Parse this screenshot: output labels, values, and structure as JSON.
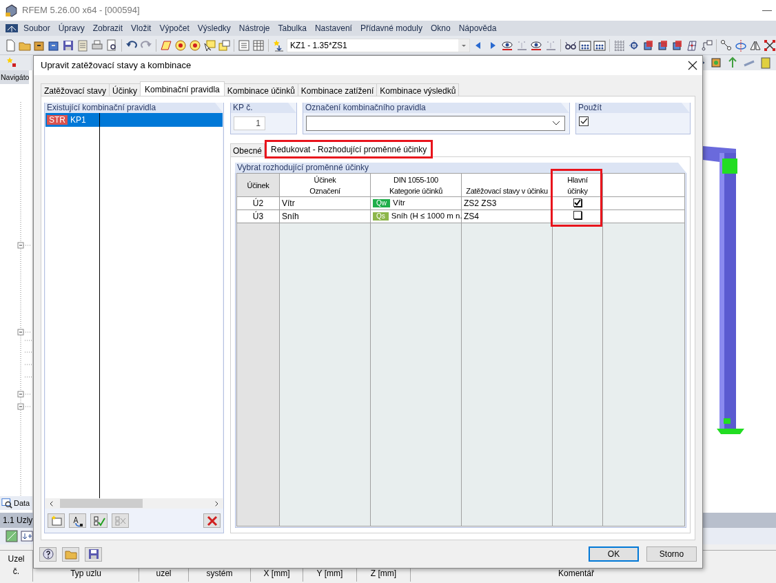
{
  "app": {
    "title": "RFEM 5.26.00 x64 - [000594]",
    "menu": [
      {
        "label": "Soubor"
      },
      {
        "label": "Úpravy"
      },
      {
        "label": "Zobrazit"
      },
      {
        "label": "Vložit"
      },
      {
        "label": "Výpočet"
      },
      {
        "label": "Výsledky"
      },
      {
        "label": "Nástroje"
      },
      {
        "label": "Tabulka"
      },
      {
        "label": "Nastavení"
      },
      {
        "label": "Přídavné moduly"
      },
      {
        "label": "Okno"
      },
      {
        "label": "Nápověda"
      }
    ],
    "load_combo": "KZ1 - 1.35*ZS1",
    "navigator_title": "Navigáto",
    "data_tab": "Data",
    "table_title": "1.1 Uzly",
    "table_columns": [
      "Typ uzlu",
      "uzel",
      "systém",
      "X [mm]",
      "Y [mm]",
      "Z [mm]",
      "Komentář"
    ],
    "first_column": [
      "Uzel",
      "č."
    ]
  },
  "dialog": {
    "title": "Upravit zatěžovací stavy a kombinace",
    "tabs": [
      {
        "label": "Zatěžovací stavy",
        "selected": false
      },
      {
        "label": "Účinky",
        "selected": false
      },
      {
        "label": "Kombinační pravidla",
        "selected": true
      },
      {
        "label": "Kombinace účinků",
        "selected": false
      },
      {
        "label": "Kombinace zatížení",
        "selected": false
      },
      {
        "label": "Kombinace výsledků",
        "selected": false
      }
    ],
    "rules_list": {
      "title": "Existující kombinační pravidla",
      "items": [
        {
          "tag": "STR",
          "label": "KP1",
          "selected": true
        }
      ]
    },
    "number": {
      "label": "KP č.",
      "value": "1"
    },
    "designation": {
      "label": "Označení kombinačního pravidla"
    },
    "use": {
      "label": "Použít",
      "checked": true
    },
    "subtabs": [
      {
        "label": "Obecné",
        "selected": false,
        "highlighted": false
      },
      {
        "label": "Redukovat - Rozhodující proměnné účinky",
        "selected": true,
        "highlighted": true
      }
    ],
    "section_title": "Vybrat rozhodující proměnné účinky",
    "table": {
      "columns": [
        {
          "lines": [
            "Účinek"
          ],
          "highlighted": false
        },
        {
          "lines": [
            "Účinek",
            "Označení"
          ],
          "highlighted": false
        },
        {
          "lines": [
            "DIN 1055-100",
            "Kategorie účinků"
          ],
          "highlighted": false
        },
        {
          "lines": [
            "Zatěžovací stavy v účinku"
          ],
          "highlighted": false
        },
        {
          "lines": [
            "Hlavní",
            "účinky"
          ],
          "highlighted": true
        },
        {
          "highlighted": false
        }
      ],
      "rows": [
        {
          "id": "Ú2",
          "name": "Vítr",
          "code": "Qw",
          "color": "#1fae4b",
          "category": "Vítr",
          "load_cases": "ZS2 ZS3",
          "leading": true
        },
        {
          "id": "Ú3",
          "name": "Sníh",
          "code": "Qs",
          "color": "#8db64a",
          "category": "Sníh (H ≤ 1000 m n.",
          "load_cases": "ZS4",
          "leading": false
        }
      ]
    },
    "buttons": [
      {
        "label": "OK",
        "default": true
      },
      {
        "label": "Storno",
        "default": false
      }
    ]
  }
}
